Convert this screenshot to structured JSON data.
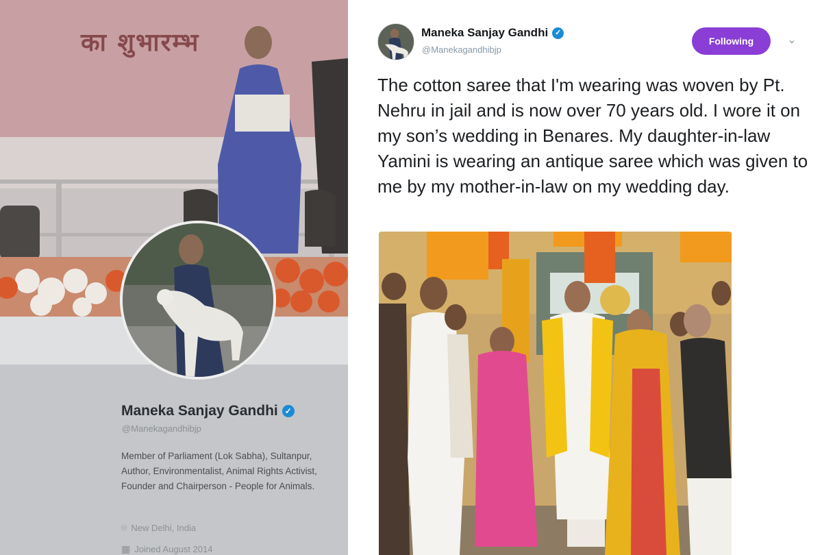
{
  "profile": {
    "banner_text": "का शुभारम्भ",
    "name": "Maneka Sanjay Gandhi",
    "handle": "@Manekagandhibjp",
    "bio": "Member of Parliament (Lok Sabha), Sultanpur, Author, Environmentalist, Animal Rights Activist, Founder and Chairperson - People for Animals.",
    "location": "New Delhi, India",
    "joined": "Joined August 2014",
    "icons": {
      "verified": "verified-badge-icon",
      "location": "map-pin-icon",
      "joined": "calendar-icon"
    }
  },
  "tweet": {
    "author_name": "Maneka Sanjay Gandhi",
    "author_handle": "@Manekagandhibjp",
    "follow_label": "Following",
    "menu_icon": "chevron-down-icon",
    "text": "The cotton saree that I'm wearing was woven by Pt. Nehru in jail and is now over 70 years old. I wore it on my son’s wedding in Benares. My daughter-in-law Yamini is wearing an antique saree which was given to me by my mother-in-law on my wedding day.",
    "accent_color": "#8a3ed6",
    "verified_color": "#1b8bd6"
  }
}
